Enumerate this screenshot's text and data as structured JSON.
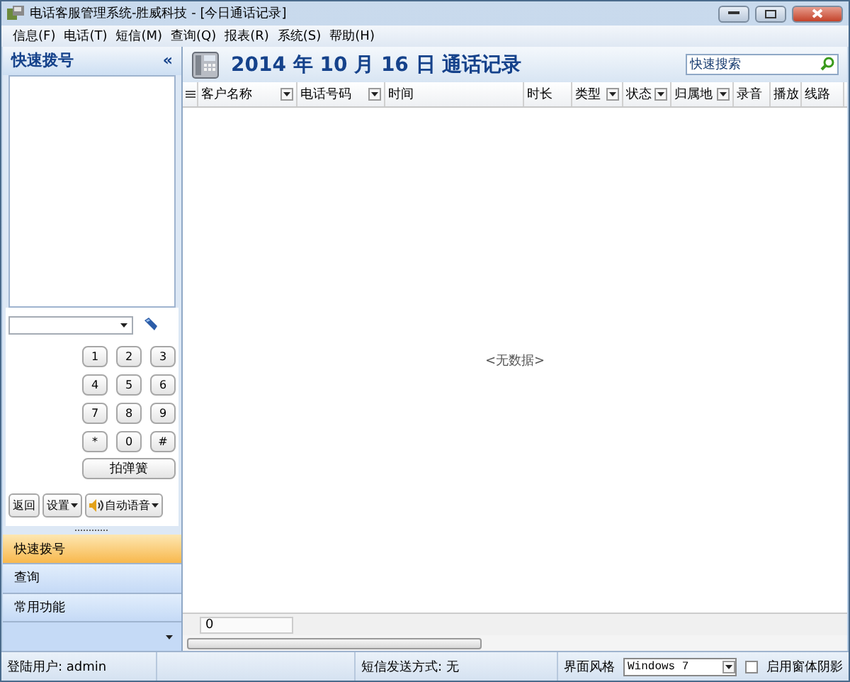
{
  "window": {
    "title": "电话客服管理系统-胜威科技 - [今日通话记录]"
  },
  "menu": [
    "信息(F)",
    "电话(T)",
    "短信(M)",
    "查询(Q)",
    "报表(R)",
    "系统(S)",
    "帮助(H)"
  ],
  "sidebar": {
    "title": "快速拨号",
    "collapse": "«",
    "keys": [
      "1",
      "2",
      "3",
      "4",
      "5",
      "6",
      "7",
      "8",
      "9",
      "*",
      "0",
      "#"
    ],
    "flash_button": "拍弹簧",
    "buttons": [
      {
        "label": "返回",
        "kind": "plain"
      },
      {
        "label": "设置",
        "kind": "dropdown"
      },
      {
        "label": "自动语音",
        "kind": "speaker"
      }
    ],
    "nav": [
      {
        "label": "快速拨号",
        "selected": true
      },
      {
        "label": "查询",
        "selected": false
      },
      {
        "label": "常用功能",
        "selected": false
      }
    ]
  },
  "header": {
    "title": "2014 年 10 月 16 日 通话记录",
    "search_placeholder": "快速搜索"
  },
  "table": {
    "columns": [
      {
        "label": "客户名称",
        "filter": true
      },
      {
        "label": "电话号码",
        "filter": true
      },
      {
        "label": "时间",
        "filter": false
      },
      {
        "label": "时长",
        "filter": false
      },
      {
        "label": "类型",
        "filter": true
      },
      {
        "label": "状态",
        "filter": true
      },
      {
        "label": "归属地",
        "filter": true
      },
      {
        "label": "录音",
        "filter": false
      },
      {
        "label": "播放",
        "filter": false
      },
      {
        "label": "线路",
        "filter": false
      }
    ],
    "empty_text": "<无数据>",
    "footer_count": "0"
  },
  "status_bar": {
    "user": "登陆用户: admin",
    "sms": "短信发送方式: 无",
    "theme_label": "界面风格",
    "theme_value": "Windows 7",
    "shadow_label": "启用窗体阴影",
    "shadow_checked": false
  }
}
